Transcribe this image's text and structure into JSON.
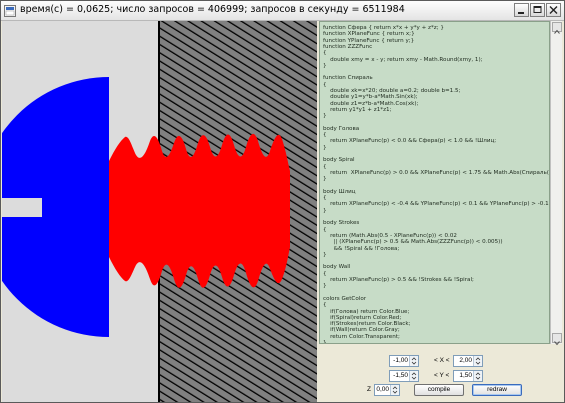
{
  "window": {
    "title": "время(с) = 0,0625; число запросов = 406999; запросов в секунду = 6511984",
    "icons": [
      "app-icon",
      "minimize-icon",
      "maximize-icon",
      "close-icon"
    ]
  },
  "canvas": {
    "colors": {
      "background": "#dcdcdc",
      "head": "#0000ff",
      "spiral": "#ff0000",
      "wall": "#808080",
      "strokes": "#000000"
    }
  },
  "code_editor": {
    "lines": [
      "function Сфера { return x*x + y*y + z*z; }",
      "function XPlaneFunc { return x;}",
      "function YPlaneFunc { return y;}",
      "function ZZZFunc",
      "{",
      "    double xmy = x - y; return xmy - Math.Round(xmy, 1);",
      "}",
      "",
      "function Спираль",
      "{",
      "    double xk=x*20; double a=0.2; double b=1.5;",
      "    double y1=y*b-a*Math.Sin(xk);",
      "    double z1=z*b-a*Math.Cos(xk);",
      "    return y1*y1 + z1*z1;",
      "}",
      "",
      "body Голова",
      "{",
      "    return XPlaneFunc(p) < 0.0 && Сфера(p) < 1.0 && !Шлиц;",
      "}",
      "",
      "body Spiral",
      "{",
      "    return  XPlaneFunc(p) > 0.0 && XPlaneFunc(p) < 1.75 && Math.Abs(Спираль(p)) < 0.5;",
      "}",
      "",
      "body Шлиц",
      "{",
      "    return XPlaneFunc(p) < -0.4 && YPlaneFunc(p) < 0.1 && YPlaneFunc(p) > -0.1;",
      "}",
      "",
      "body Strokes",
      "{",
      "    return (Math.Abs(0.5 - XPlaneFunc(p)) < 0.02",
      "      || (XPlaneFunc(p) > 0.5 && Math.Abs(ZZZFunc(p)) < 0.005))",
      "      && !Spiral && !Голова;",
      "}",
      "",
      "body Wall",
      "{",
      "    return XPlaneFunc(p) > 0.5 && !Strokes && !Spiral;",
      "}",
      "",
      "colors GetColor",
      "{",
      "    if(Голова) return Color.Blue;",
      "    if(Spiral)return Color.Red;",
      "    if(Strokes)return Color.Black;",
      "    if(Wall)return Color.Gray;",
      "    return Color.Transparent;",
      "}"
    ]
  },
  "controls": {
    "x_min": "-1,00",
    "x_label": "< X <",
    "x_max": "2,00",
    "y_min": "-1,50",
    "y_label": "< Y <",
    "y_max": "1,50",
    "z_label": "Z",
    "z_value": "0,00",
    "compile_label": "compile",
    "redraw_label": "redraw"
  }
}
